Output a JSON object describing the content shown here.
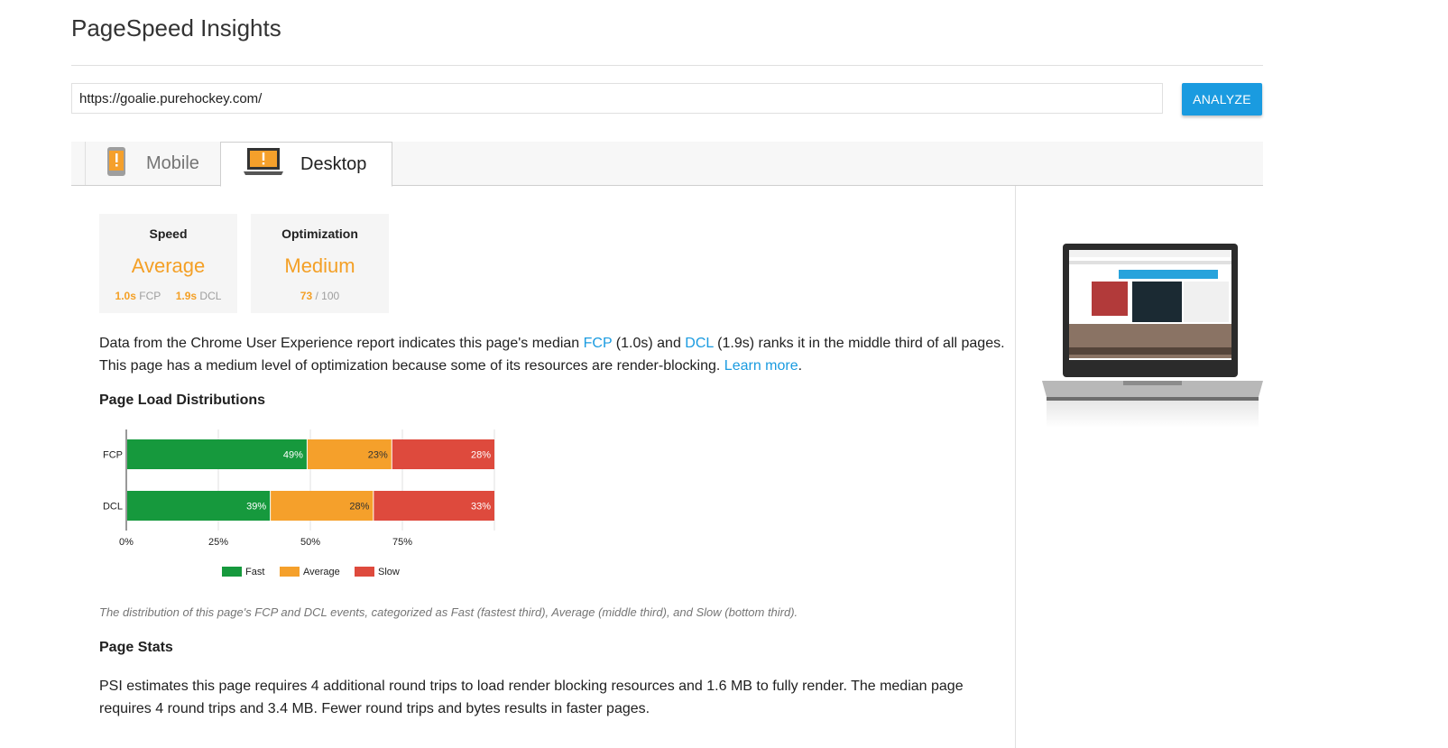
{
  "app": {
    "title": "PageSpeed Insights"
  },
  "search": {
    "url_value": "https://goalie.purehockey.com/",
    "analyze_label": "ANALYZE"
  },
  "tabs": [
    {
      "label": "Mobile",
      "selected": false,
      "icon": "mobile-warning-icon"
    },
    {
      "label": "Desktop",
      "selected": true,
      "icon": "desktop-warning-icon"
    }
  ],
  "cards": {
    "speed": {
      "title": "Speed",
      "rating": "Average",
      "fcp_value": "1.0s",
      "fcp_label": "FCP",
      "dcl_value": "1.9s",
      "dcl_label": "DCL"
    },
    "optimization": {
      "title": "Optimization",
      "rating": "Medium",
      "score": "73",
      "score_suffix": "/ 100"
    }
  },
  "summary": {
    "part1": "Data from the Chrome User Experience report indicates this page's median ",
    "fcp_link": "FCP",
    "part2": " (1.0s) and ",
    "dcl_link": "DCL",
    "part3": " (1.9s) ranks it in the middle third of all pages. This page has a medium level of optimization because some of its resources are render-blocking. ",
    "learn_more": "Learn more",
    "part4": "."
  },
  "distributions": {
    "heading": "Page Load Distributions",
    "caption": "The distribution of this page's FCP and DCL events, categorized as Fast (fastest third), Average (middle third), and Slow (bottom third)."
  },
  "chart_data": {
    "type": "bar",
    "orientation": "horizontal-stacked",
    "categories": [
      "FCP",
      "DCL"
    ],
    "series": [
      {
        "name": "Fast",
        "values": [
          49,
          39
        ],
        "labels": [
          "49%",
          "39%"
        ],
        "color": "#16993d"
      },
      {
        "name": "Average",
        "values": [
          23,
          28
        ],
        "labels": [
          "23%",
          "28%"
        ],
        "color": "#f5a02b"
      },
      {
        "name": "Slow",
        "values": [
          28,
          33
        ],
        "labels": [
          "28%",
          "33%"
        ],
        "color": "#de4a3d"
      }
    ],
    "x_ticks": [
      "0%",
      "25%",
      "50%",
      "75%"
    ],
    "xlim": [
      0,
      100
    ],
    "legend_position": "bottom"
  },
  "stats": {
    "heading": "Page Stats",
    "text": "PSI estimates this page requires 4 additional round trips to load render blocking resources and 1.6 MB to fully render. The median page requires 4 round trips and 3.4 MB. Fewer round trips and bytes results in faster pages."
  },
  "colors": {
    "accent": "#1a9be0",
    "average": "#f4a026"
  }
}
